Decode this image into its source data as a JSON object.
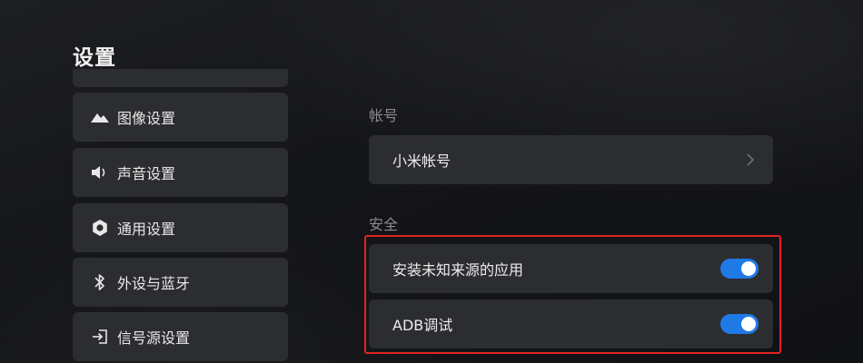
{
  "page": {
    "title": "设置"
  },
  "sidebar": {
    "items": [
      {
        "label": "图像设置",
        "icon": "picture-mountain-icon"
      },
      {
        "label": "声音设置",
        "icon": "speaker-icon"
      },
      {
        "label": "通用设置",
        "icon": "gear-icon"
      },
      {
        "label": "外设与蓝牙",
        "icon": "bluetooth-icon"
      },
      {
        "label": "信号源设置",
        "icon": "input-source-icon"
      }
    ]
  },
  "main": {
    "account": {
      "header": "帐号",
      "item_label": "小米帐号"
    },
    "security": {
      "header": "安全",
      "items": [
        {
          "label": "安装未知来源的应用",
          "enabled": true
        },
        {
          "label": "ADB调试",
          "enabled": true
        }
      ]
    }
  },
  "colors": {
    "toggle_on": "#1f7ae6",
    "highlight_border": "#e02424",
    "panel_bg": "#2c2d30"
  }
}
